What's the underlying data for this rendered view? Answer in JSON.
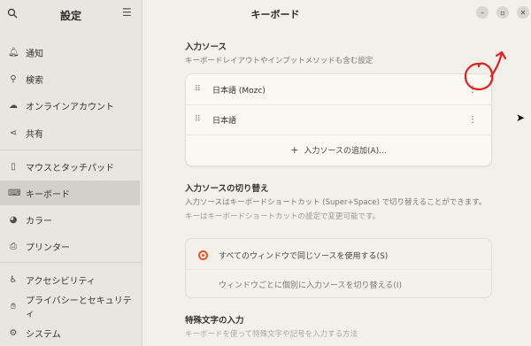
{
  "sidebar": {
    "title": "設定",
    "items": [
      {
        "label": "通知",
        "icon": "bell-icon"
      },
      {
        "label": "検索",
        "icon": "search-icon"
      },
      {
        "label": "オンラインアカウント",
        "icon": "cloud-icon"
      },
      {
        "label": "共有",
        "icon": "share-icon"
      },
      {
        "label": "マウスとタッチパッド",
        "icon": "mouse-icon"
      },
      {
        "label": "キーボード",
        "icon": "keyboard-icon",
        "active": true
      },
      {
        "label": "カラー",
        "icon": "color-icon"
      },
      {
        "label": "プリンター",
        "icon": "printer-icon"
      },
      {
        "label": "アクセシビリティ",
        "icon": "accessibility-icon"
      },
      {
        "label": "プライバシーとセキュリティ",
        "icon": "privacy-icon"
      },
      {
        "label": "システム",
        "icon": "system-icon"
      }
    ]
  },
  "header": {
    "title": "キーボード"
  },
  "input_sources": {
    "title": "入力ソース",
    "subtitle": "キーボードレイアウトやインプットメソッドも含む設定",
    "sources": [
      {
        "label": "日本語 (Mozc)"
      },
      {
        "label": "日本語"
      }
    ],
    "add_label": "入力ソースの追加(A)..."
  },
  "switching": {
    "title": "入力ソースの切り替え",
    "desc1": "入力ソースはキーボードショートカット (Super+Space) で切り替えることができます。",
    "desc2": "キーはキーボードショートカットの設定で変更可能です。",
    "options": [
      {
        "label": "すべてのウィンドウで同じソースを使用する(S)",
        "selected": true
      },
      {
        "label": "ウィンドウごとに個別に入力ソースを切り替える(I)",
        "selected": false
      }
    ]
  },
  "special": {
    "title": "特殊文字の入力",
    "desc": "キーボードを使って特殊文字や記号を入力する方法"
  },
  "colors": {
    "accent": "#e8542a",
    "annotation": "#e0201f"
  }
}
